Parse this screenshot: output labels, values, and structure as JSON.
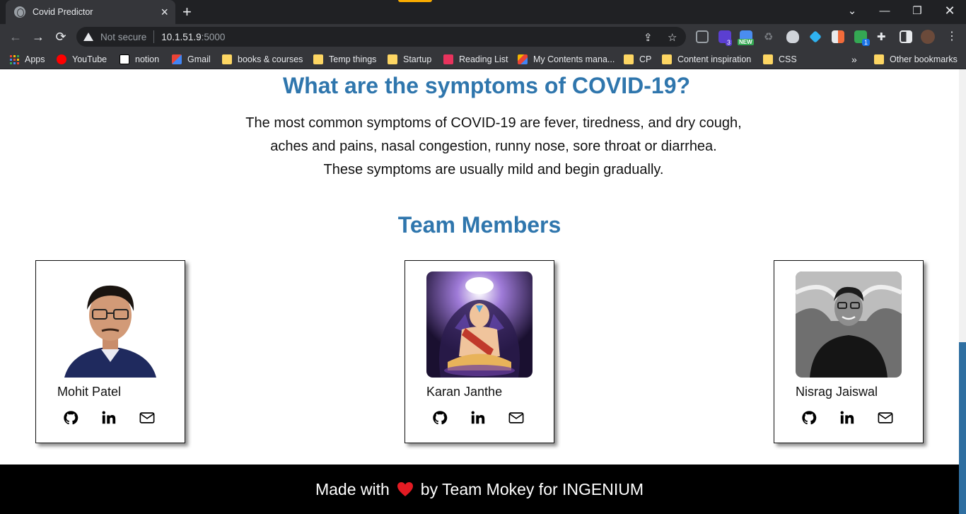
{
  "browser": {
    "tab_title": "Covid Predictor",
    "omnibox": {
      "security": "Not secure",
      "host": "10.1.51.9",
      "port": ":5000"
    },
    "badges": {
      "ext1": "3",
      "ext2": "NEW",
      "ext3": "1"
    },
    "bookmarks": [
      {
        "label": "Apps",
        "icon": "apps-grid-icon"
      },
      {
        "label": "YouTube",
        "icon": "youtube-icon"
      },
      {
        "label": "notion",
        "icon": "notion-icon"
      },
      {
        "label": "Gmail",
        "icon": "gmail-icon"
      },
      {
        "label": "books & courses",
        "icon": "folder-icon"
      },
      {
        "label": "Temp things",
        "icon": "folder-icon"
      },
      {
        "label": "Startup",
        "icon": "folder-icon"
      },
      {
        "label": "Reading List",
        "icon": "reading-list-icon"
      },
      {
        "label": "My Contents mana...",
        "icon": "bookmark-site-icon"
      },
      {
        "label": "CP",
        "icon": "folder-icon"
      },
      {
        "label": "Content inspiration",
        "icon": "folder-icon"
      },
      {
        "label": "CSS",
        "icon": "folder-icon"
      }
    ],
    "overflow": "»",
    "other_bookmarks": "Other bookmarks"
  },
  "page": {
    "symptoms": {
      "heading": "What are the symptoms of COVID-19?",
      "lines": [
        "The most common symptoms of COVID-19 are fever, tiredness, and dry cough,",
        "aches and pains, nasal congestion, runny nose, sore throat or diarrhea.",
        "These symptoms are usually mild and begin gradually."
      ]
    },
    "team": {
      "heading": "Team Members",
      "members": [
        {
          "name": "Mohit Patel"
        },
        {
          "name": "Karan Janthe"
        },
        {
          "name": "Nisrag Jaiswal"
        }
      ]
    },
    "footer": {
      "before": "Made with",
      "after": "by Team Mokey for INGENIUM"
    }
  },
  "colors": {
    "heading": "#2f76ad",
    "footer_bg": "#000000",
    "heart": "#e31b23",
    "chrome_dark": "#202124",
    "chrome_toolbar": "#35363a"
  }
}
